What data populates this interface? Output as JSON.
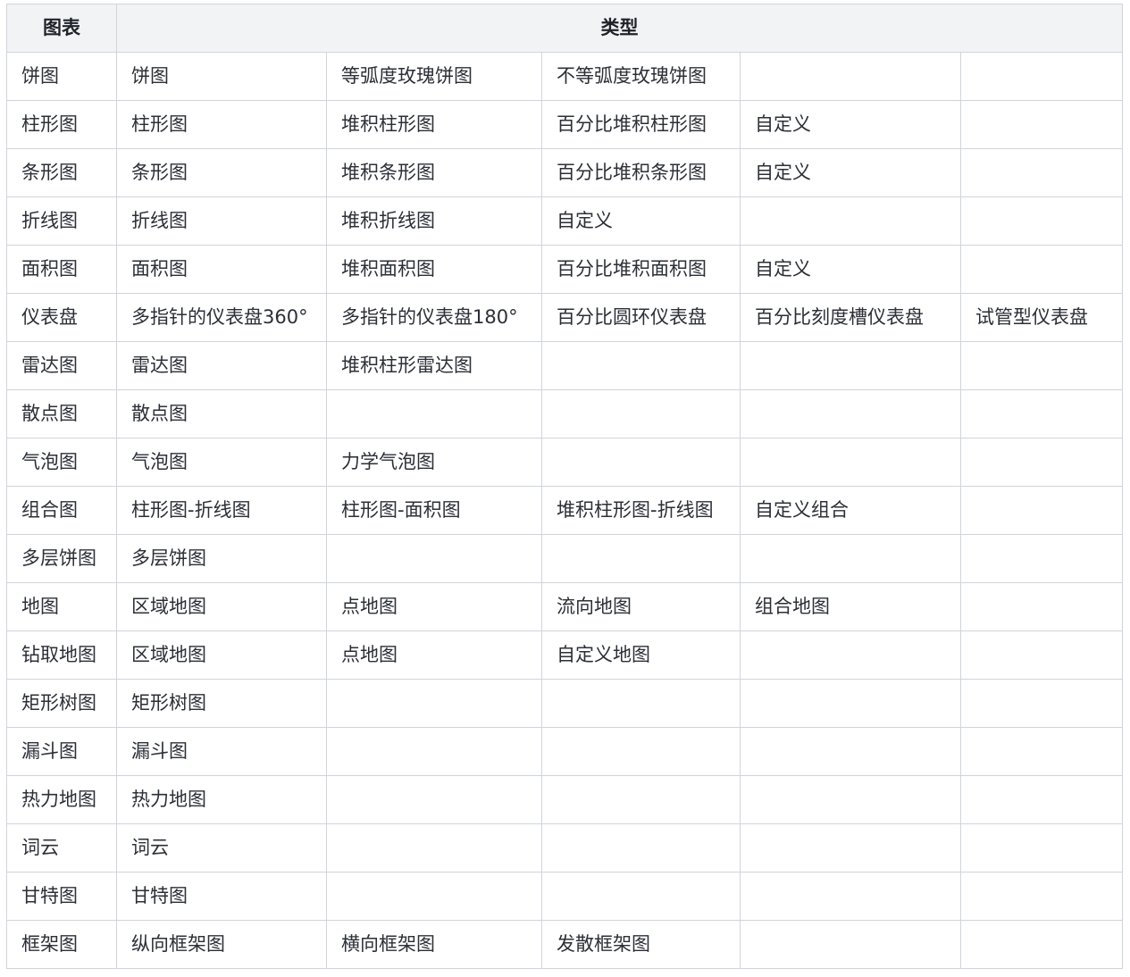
{
  "header": {
    "chart_label": "图表",
    "type_label": "类型"
  },
  "rows": [
    {
      "name": "饼图",
      "types": [
        "饼图",
        "等弧度玫瑰饼图",
        "不等弧度玫瑰饼图",
        "",
        ""
      ]
    },
    {
      "name": "柱形图",
      "types": [
        "柱形图",
        "堆积柱形图",
        "百分比堆积柱形图",
        "自定义",
        ""
      ]
    },
    {
      "name": "条形图",
      "types": [
        "条形图",
        "堆积条形图",
        "百分比堆积条形图",
        "自定义",
        ""
      ]
    },
    {
      "name": "折线图",
      "types": [
        "折线图",
        "堆积折线图",
        "自定义",
        "",
        ""
      ]
    },
    {
      "name": "面积图",
      "types": [
        "面积图",
        "堆积面积图",
        "百分比堆积面积图",
        "自定义",
        ""
      ]
    },
    {
      "name": "仪表盘",
      "types": [
        "多指针的仪表盘360°",
        "多指针的仪表盘180°",
        "百分比圆环仪表盘",
        "百分比刻度槽仪表盘",
        "试管型仪表盘"
      ]
    },
    {
      "name": "雷达图",
      "types": [
        "雷达图",
        "堆积柱形雷达图",
        "",
        "",
        ""
      ]
    },
    {
      "name": "散点图",
      "types": [
        "散点图",
        "",
        "",
        "",
        ""
      ]
    },
    {
      "name": "气泡图",
      "types": [
        "气泡图",
        "力学气泡图",
        "",
        "",
        ""
      ]
    },
    {
      "name": "组合图",
      "types": [
        "柱形图-折线图",
        "柱形图-面积图",
        "堆积柱形图-折线图",
        "自定义组合",
        ""
      ]
    },
    {
      "name": "多层饼图",
      "types": [
        "多层饼图",
        "",
        "",
        "",
        ""
      ]
    },
    {
      "name": "地图",
      "types": [
        "区域地图",
        "点地图",
        "流向地图",
        "组合地图",
        ""
      ]
    },
    {
      "name": "钻取地图",
      "types": [
        "区域地图",
        "点地图",
        "自定义地图",
        "",
        ""
      ]
    },
    {
      "name": "矩形树图",
      "types": [
        "矩形树图",
        "",
        "",
        "",
        ""
      ]
    },
    {
      "name": "漏斗图",
      "types": [
        "漏斗图",
        "",
        "",
        "",
        ""
      ]
    },
    {
      "name": "热力地图",
      "types": [
        "热力地图",
        "",
        "",
        "",
        ""
      ]
    },
    {
      "name": "词云",
      "types": [
        "词云",
        "",
        "",
        "",
        ""
      ]
    },
    {
      "name": "甘特图",
      "types": [
        "甘特图",
        "",
        "",
        "",
        ""
      ]
    },
    {
      "name": "框架图",
      "types": [
        "纵向框架图",
        "横向框架图",
        "发散框架图",
        "",
        ""
      ]
    }
  ],
  "colors": {
    "border": "#d0d4da",
    "header_bg": "#f2f3f5",
    "text": "#2b2f36"
  }
}
